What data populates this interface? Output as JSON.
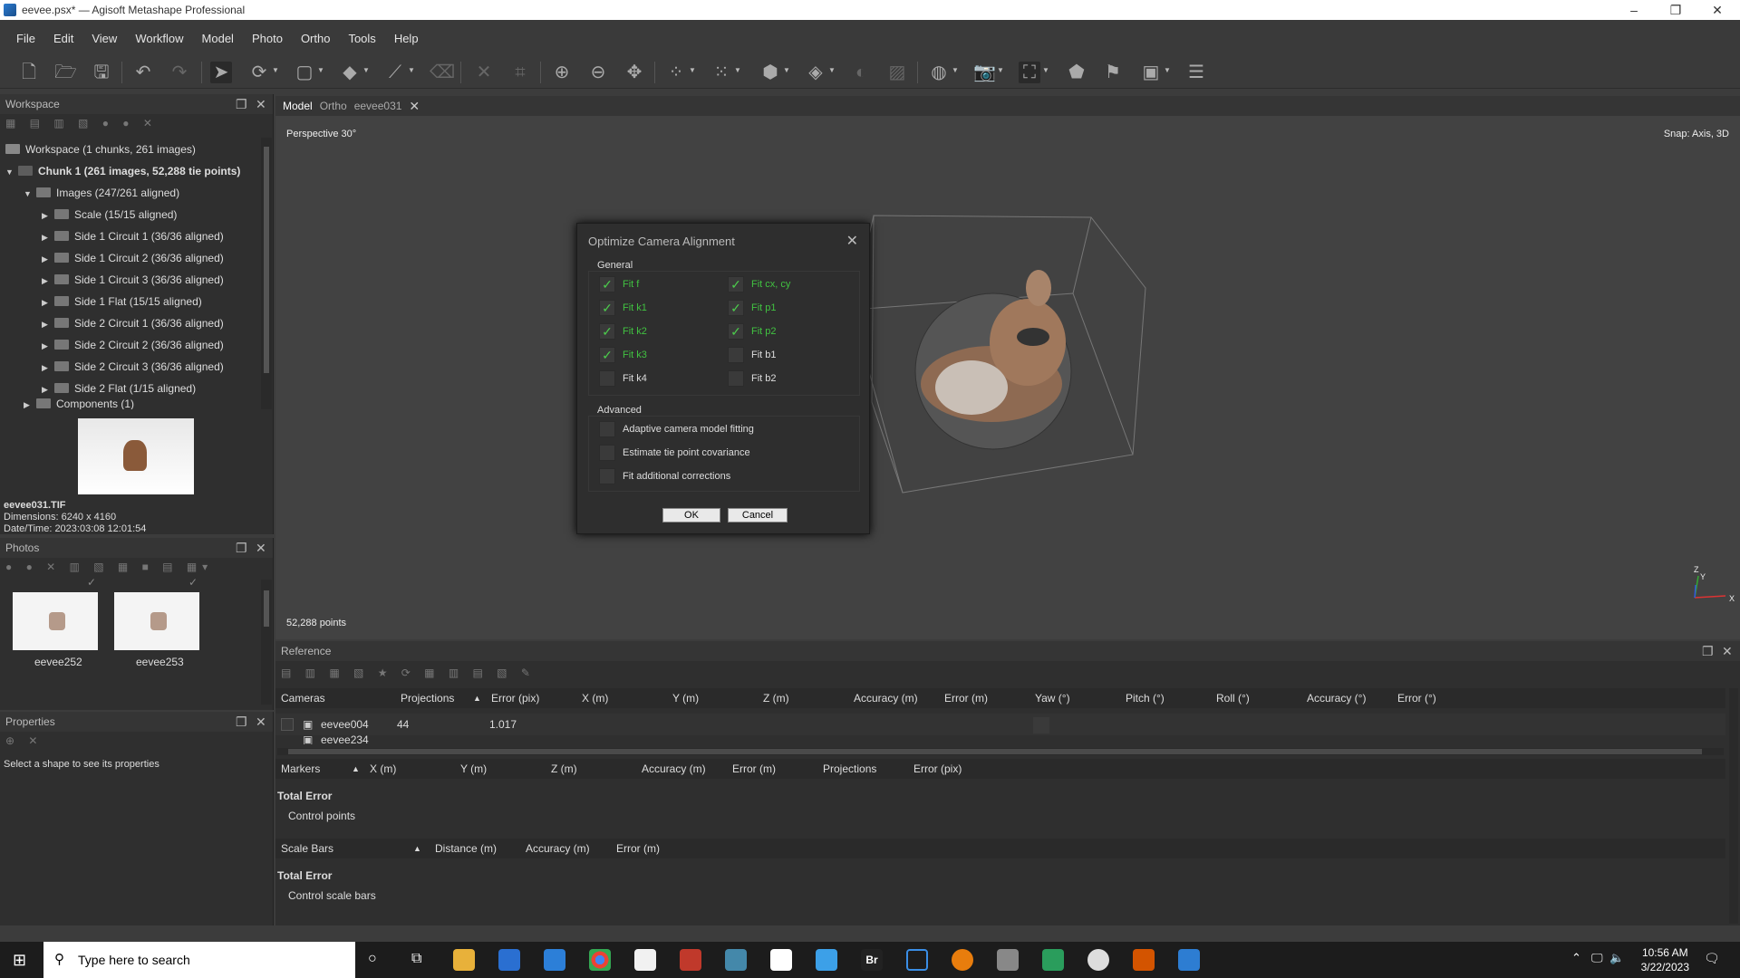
{
  "window": {
    "title": "eevee.psx* — Agisoft Metashape Professional",
    "controls": [
      "minimize-icon",
      "restore-icon",
      "close-icon"
    ]
  },
  "menu": [
    "File",
    "Edit",
    "View",
    "Workflow",
    "Model",
    "Photo",
    "Ortho",
    "Tools",
    "Help"
  ],
  "workspace": {
    "title": "Workspace",
    "root": "Workspace (1 chunks, 261 images)",
    "chunk": "Chunk 1 (261 images, 52,288 tie points)",
    "images_folder": "Images (247/261 aligned)",
    "groups": [
      "Scale (15/15 aligned)",
      "Side 1 Circuit 1 (36/36 aligned)",
      "Side 1 Circuit 2 (36/36 aligned)",
      "Side 1 Circuit 3 (36/36 aligned)",
      "Side 1 Flat (15/15 aligned)",
      "Side 2 Circuit 1 (36/36 aligned)",
      "Side 2 Circuit 2 (36/36 aligned)",
      "Side 2 Circuit 3 (36/36 aligned)",
      "Side 2 Flat (1/15 aligned)"
    ],
    "components": "Components (1)"
  },
  "image_info": {
    "filename": "eevee031.TIF",
    "dimensions": "Dimensions: 6240 x 4160",
    "datetime": "Date/Time: 2023:03:08 12:01:54"
  },
  "photos": {
    "title": "Photos",
    "items": [
      "eevee252",
      "eevee253"
    ]
  },
  "properties": {
    "title": "Properties",
    "hint": "Select a shape to see its properties"
  },
  "tabs": [
    "Model",
    "Ortho",
    "eevee031"
  ],
  "viewport": {
    "projection": "Perspective 30°",
    "snap": "Snap: Axis, 3D",
    "points": "52,288 points",
    "axis_labels": [
      "Z",
      "Y",
      "X"
    ]
  },
  "dialog": {
    "title": "Optimize Camera Alignment",
    "general_label": "General",
    "general_left": [
      {
        "label": "Fit f",
        "checked": true
      },
      {
        "label": "Fit k1",
        "checked": true
      },
      {
        "label": "Fit k2",
        "checked": true
      },
      {
        "label": "Fit k3",
        "checked": true
      },
      {
        "label": "Fit k4",
        "checked": false
      }
    ],
    "general_right": [
      {
        "label": "Fit cx, cy",
        "checked": true
      },
      {
        "label": "Fit p1",
        "checked": true
      },
      {
        "label": "Fit p2",
        "checked": true
      },
      {
        "label": "Fit b1",
        "checked": false
      },
      {
        "label": "Fit b2",
        "checked": false
      }
    ],
    "advanced_label": "Advanced",
    "advanced": [
      {
        "label": "Adaptive camera model fitting",
        "checked": false
      },
      {
        "label": "Estimate tie point covariance",
        "checked": false
      },
      {
        "label": "Fit additional corrections",
        "checked": false
      }
    ],
    "ok": "OK",
    "cancel": "Cancel",
    "checked_color": "#41c241"
  },
  "reference": {
    "title": "Reference",
    "camera_cols": [
      "Cameras",
      "Projections",
      "Error (pix)",
      "X (m)",
      "Y (m)",
      "Z (m)",
      "Accuracy (m)",
      "Error (m)",
      "Yaw (°)",
      "Pitch (°)",
      "Roll (°)",
      "Accuracy (°)",
      "Error (°)"
    ],
    "camera_rows": [
      {
        "name": "eevee004",
        "projections": "44",
        "error": "1.017"
      },
      {
        "name": "eevee234",
        "projections": "",
        "error": ""
      }
    ],
    "marker_cols": [
      "Markers",
      "X (m)",
      "Y (m)",
      "Z (m)",
      "Accuracy (m)",
      "Error (m)",
      "Projections",
      "Error (pix)"
    ],
    "marker_total": "Total Error",
    "marker_sub": "Control points",
    "scale_cols": [
      "Scale Bars",
      "Distance (m)",
      "Accuracy (m)",
      "Error (m)"
    ],
    "scale_total": "Total Error",
    "scale_sub": "Control scale bars"
  },
  "taskbar": {
    "search_placeholder": "Type here to search",
    "time": "10:56 AM",
    "date": "3/22/2023"
  }
}
